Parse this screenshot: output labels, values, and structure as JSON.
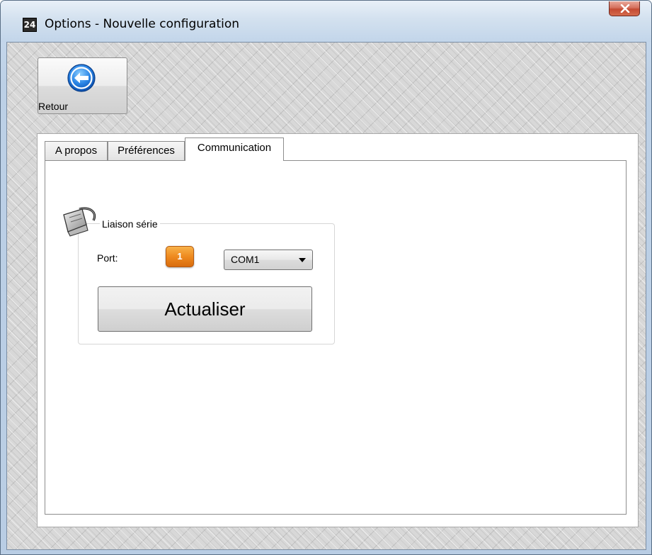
{
  "window": {
    "title": "Options - Nouvelle configuration",
    "app_icon_glyph": "24",
    "close_icon": "close-x-icon"
  },
  "toolbar": {
    "back_label": "Retour",
    "back_icon": "back-arrow-icon"
  },
  "tabs": [
    {
      "label": "A propos",
      "active": false
    },
    {
      "label": "Préférences",
      "active": false
    },
    {
      "label": "Communication",
      "active": true
    }
  ],
  "communication": {
    "group_title": "Liaison série",
    "group_icon": "serial-cable-icon",
    "port_label": "Port:",
    "port_badge": "1",
    "port_value": "COM1",
    "refresh_label": "Actualiser"
  },
  "colors": {
    "badge_orange": "#ee8a1f",
    "close_red": "#c44a33",
    "back_icon_blue": "#1e6fd2"
  }
}
